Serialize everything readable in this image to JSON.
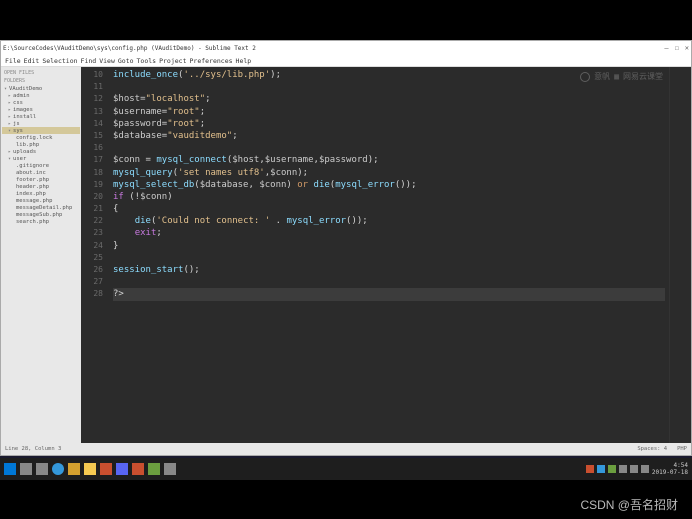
{
  "titlebar": {
    "text": "E:\\SourceCodes\\VAuditDemo\\sys\\config.php (VAuditDemo) - Sublime Text 2",
    "min": "—",
    "max": "☐",
    "close": "✕"
  },
  "menu": [
    "File",
    "Edit",
    "Selection",
    "Find",
    "View",
    "Goto",
    "Tools",
    "Project",
    "Preferences",
    "Help"
  ],
  "sidebar": {
    "heading1": "OPEN FILES",
    "heading2": "FOLDERS",
    "items": [
      {
        "label": "VAuditDemo",
        "lvl": 0,
        "sel": false,
        "tri": "▾"
      },
      {
        "label": "admin",
        "lvl": 1,
        "sel": false,
        "tri": "▸"
      },
      {
        "label": "css",
        "lvl": 1,
        "sel": false,
        "tri": "▸"
      },
      {
        "label": "images",
        "lvl": 1,
        "sel": false,
        "tri": "▸"
      },
      {
        "label": "install",
        "lvl": 1,
        "sel": false,
        "tri": "▸"
      },
      {
        "label": "js",
        "lvl": 1,
        "sel": false,
        "tri": "▸"
      },
      {
        "label": "sys",
        "lvl": 1,
        "sel": true,
        "tri": "▾"
      },
      {
        "label": "config.lock",
        "lvl": 2,
        "sel": false,
        "tri": ""
      },
      {
        "label": "lib.php",
        "lvl": 2,
        "sel": false,
        "tri": ""
      },
      {
        "label": "uploads",
        "lvl": 1,
        "sel": false,
        "tri": "▸"
      },
      {
        "label": "user",
        "lvl": 1,
        "sel": false,
        "tri": "▾"
      },
      {
        "label": ".gitignore",
        "lvl": 2,
        "sel": false,
        "tri": ""
      },
      {
        "label": "about.inc",
        "lvl": 2,
        "sel": false,
        "tri": ""
      },
      {
        "label": "footer.php",
        "lvl": 2,
        "sel": false,
        "tri": ""
      },
      {
        "label": "header.php",
        "lvl": 2,
        "sel": false,
        "tri": ""
      },
      {
        "label": "index.php",
        "lvl": 2,
        "sel": false,
        "tri": ""
      },
      {
        "label": "message.php",
        "lvl": 2,
        "sel": false,
        "tri": ""
      },
      {
        "label": "messageDetail.php",
        "lvl": 2,
        "sel": false,
        "tri": ""
      },
      {
        "label": "messageSub.php",
        "lvl": 2,
        "sel": false,
        "tri": ""
      },
      {
        "label": "search.php",
        "lvl": 2,
        "sel": false,
        "tri": ""
      }
    ]
  },
  "lines": {
    "start": 10,
    "end": 28,
    "code": [
      [
        [
          "fn",
          "include_once"
        ],
        [
          "op",
          "("
        ],
        [
          "str",
          "'../sys/lib.php'"
        ],
        [
          "op",
          ");"
        ]
      ],
      [],
      [
        [
          "var",
          "$host"
        ],
        [
          "op",
          "="
        ],
        [
          "str",
          "\"localhost\""
        ],
        [
          "op",
          ";"
        ]
      ],
      [
        [
          "var",
          "$username"
        ],
        [
          "op",
          "="
        ],
        [
          "str",
          "\"root\""
        ],
        [
          "op",
          ";"
        ]
      ],
      [
        [
          "var",
          "$password"
        ],
        [
          "op",
          "="
        ],
        [
          "str",
          "\"root\""
        ],
        [
          "op",
          ";"
        ]
      ],
      [
        [
          "var",
          "$database"
        ],
        [
          "op",
          "="
        ],
        [
          "str",
          "\"vauditdemo\""
        ],
        [
          "op",
          ";"
        ]
      ],
      [],
      [
        [
          "var",
          "$conn "
        ],
        [
          "op",
          "= "
        ],
        [
          "fn",
          "mysql_connect"
        ],
        [
          "op",
          "("
        ],
        [
          "var",
          "$host"
        ],
        [
          "op",
          ","
        ],
        [
          "var",
          "$username"
        ],
        [
          "op",
          ","
        ],
        [
          "var",
          "$password"
        ],
        [
          "op",
          ");"
        ]
      ],
      [
        [
          "fn",
          "mysql_query"
        ],
        [
          "op",
          "("
        ],
        [
          "str",
          "'set names utf8'"
        ],
        [
          "op",
          ","
        ],
        [
          "var",
          "$conn"
        ],
        [
          "op",
          ");"
        ]
      ],
      [
        [
          "fn",
          "mysql_select_db"
        ],
        [
          "op",
          "("
        ],
        [
          "var",
          "$database"
        ],
        [
          "op",
          ", "
        ],
        [
          "var",
          "$conn"
        ],
        [
          "op",
          ") "
        ],
        [
          "kw",
          "or"
        ],
        [
          "op",
          " "
        ],
        [
          "fn",
          "die"
        ],
        [
          "op",
          "("
        ],
        [
          "fn",
          "mysql_error"
        ],
        [
          "op",
          "());"
        ]
      ],
      [
        [
          "ctrl",
          "if"
        ],
        [
          "op",
          " (!"
        ],
        [
          "var",
          "$conn"
        ],
        [
          "op",
          ")"
        ]
      ],
      [
        [
          "op",
          "{"
        ]
      ],
      [
        [
          "op",
          "    "
        ],
        [
          "fn",
          "die"
        ],
        [
          "op",
          "("
        ],
        [
          "str",
          "'Could not connect: '"
        ],
        [
          "op",
          " . "
        ],
        [
          "fn",
          "mysql_error"
        ],
        [
          "op",
          "());"
        ]
      ],
      [
        [
          "op",
          "    "
        ],
        [
          "ctrl",
          "exit"
        ],
        [
          "op",
          ";"
        ]
      ],
      [
        [
          "op",
          "}"
        ]
      ],
      [],
      [
        [
          "fn",
          "session_start"
        ],
        [
          "op",
          "();"
        ]
      ],
      [],
      [
        [
          "op",
          "?>"
        ]
      ]
    ],
    "highlighted": 28
  },
  "watermark": {
    "a": "意帆",
    "b": "网易云课堂"
  },
  "statusbar": {
    "left": "Line 28, Column 3",
    "right_a": "Spaces: 4",
    "right_b": "PHP"
  },
  "taskbar": {
    "clock_time": "4:54",
    "clock_date": "2019-07-18"
  },
  "caption": "CSDN @吾名招财"
}
